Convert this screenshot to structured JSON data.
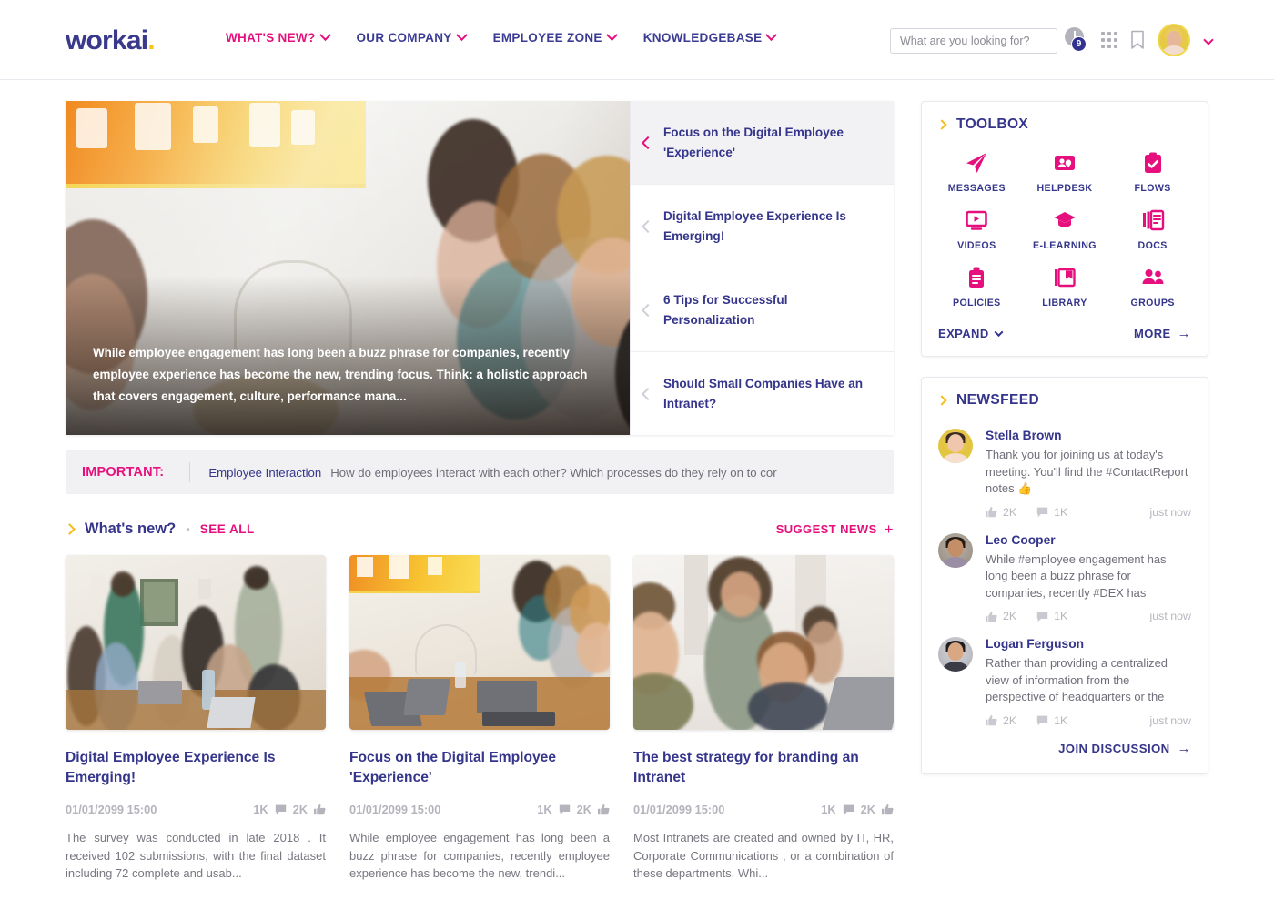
{
  "brand": {
    "name": "workai",
    "dot": ".",
    "color_indigo": "#35358c",
    "color_pink": "#e5107e",
    "color_yellow": "#f5bb18"
  },
  "header": {
    "nav": [
      {
        "label": "WHAT'S NEW?",
        "active": true
      },
      {
        "label": "OUR COMPANY",
        "active": false
      },
      {
        "label": "EMPLOYEE ZONE",
        "active": false
      },
      {
        "label": "KNOWLEDGEBASE",
        "active": false
      }
    ],
    "search_placeholder": "What are you looking for?",
    "search_value": "",
    "notification_count": "9"
  },
  "hero": {
    "caption": "While employee engagement has long been a buzz phrase for companies, recently employee experience has become the new, trending focus. Think: a holistic approach that covers engagement, culture, performance mana...",
    "items": [
      {
        "title": "Focus on the Digital Employee 'Experience'",
        "active": true
      },
      {
        "title": "Digital Employee Experience Is Emerging!",
        "active": false
      },
      {
        "title": "6 Tips for Successful Personalization",
        "active": false
      },
      {
        "title": "Should Small Companies Have an Intranet?",
        "active": false
      }
    ]
  },
  "ticker": {
    "label": "IMPORTANT:",
    "title": "Employee Interaction",
    "body": "How do employees interact with each other? Which processes do they rely on to cor"
  },
  "whats_new": {
    "title": "What's new?",
    "bullet": "•",
    "see_all": "SEE ALL",
    "suggest": "SUGGEST NEWS",
    "plus": "+",
    "cards": [
      {
        "title": "Digital Employee Experience Is Emerging!",
        "date": "01/01/2099 15:00",
        "comments": "1K",
        "likes": "2K",
        "body": "The survey was conducted in late 2018 . It received 102 submissions, with the final dataset including 72 complete and usab..."
      },
      {
        "title": "Focus on the Digital Employee 'Experience'",
        "date": "01/01/2099 15:00",
        "comments": "1K",
        "likes": "2K",
        "body": "While employee engagement has long been a buzz phrase for companies, recently employee experience has become the new, trendi..."
      },
      {
        "title": "The best strategy for branding an Intranet",
        "date": "01/01/2099 15:00",
        "comments": "1K",
        "likes": "2K",
        "body": "Most Intranets are created and owned by IT, HR, Corporate Communications , or a combination of these departments. Whi..."
      }
    ]
  },
  "toolbox": {
    "title": "TOOLBOX",
    "items": [
      {
        "label": "MESSAGES",
        "icon": "paper-plane-icon"
      },
      {
        "label": "HELPDESK",
        "icon": "contact-card-icon"
      },
      {
        "label": "FLOWS",
        "icon": "clipboard-check-icon"
      },
      {
        "label": "VIDEOS",
        "icon": "video-monitor-icon"
      },
      {
        "label": "E-LEARNING",
        "icon": "graduation-cap-icon"
      },
      {
        "label": "DOCS",
        "icon": "documents-icon"
      },
      {
        "label": "POLICIES",
        "icon": "clipboard-lines-icon"
      },
      {
        "label": "LIBRARY",
        "icon": "books-icon"
      },
      {
        "label": "GROUPS",
        "icon": "people-icon"
      }
    ],
    "expand": "EXPAND",
    "more": "MORE",
    "more_arrow": "→"
  },
  "newsfeed": {
    "title": "NEWSFEED",
    "posts": [
      {
        "name": "Stella Brown",
        "text": "Thank you for joining us at today's meeting. You'll find the #ContactReport notes 👍",
        "likes": "2K",
        "comments": "1K",
        "time": "just now"
      },
      {
        "name": "Leo Cooper",
        "text": "While #employee engagement has long been a buzz phrase for companies, recently #DEX has",
        "likes": "2K",
        "comments": "1K",
        "time": "just now"
      },
      {
        "name": "Logan Ferguson",
        "text": "Rather than providing a centralized view of information from the perspective of headquarters or the",
        "likes": "2K",
        "comments": "1K",
        "time": "just now"
      }
    ],
    "join": "JOIN DISCUSSION",
    "join_arrow": "→"
  }
}
